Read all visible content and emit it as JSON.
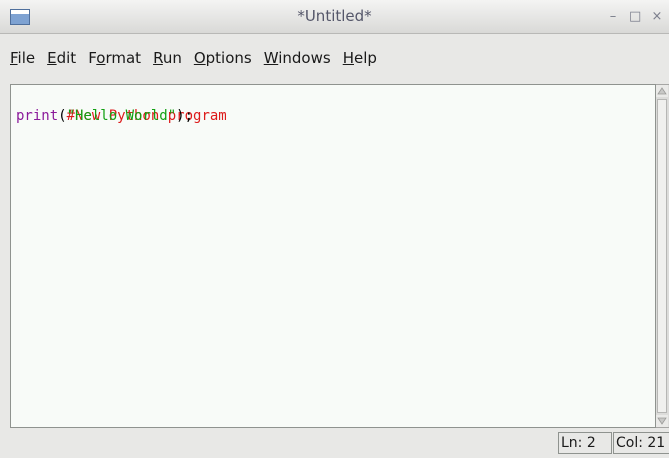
{
  "window": {
    "title": "*Untitled*",
    "controls": {
      "minimize": "–",
      "maximize": "□",
      "close": "×"
    }
  },
  "menu": {
    "items": [
      {
        "mnemonic": "F",
        "rest": "ile"
      },
      {
        "mnemonic": "E",
        "rest": "dit"
      },
      {
        "pre": "F",
        "mnemonic": "o",
        "rest": "rmat"
      },
      {
        "mnemonic": "R",
        "rest": "un"
      },
      {
        "mnemonic": "O",
        "rest": "ptions"
      },
      {
        "mnemonic": "W",
        "rest": "indows"
      },
      {
        "mnemonic": "H",
        "rest": "elp"
      }
    ]
  },
  "editor": {
    "line1": {
      "comment": "#New Python program"
    },
    "line2": {
      "builtin": "print",
      "open": "(",
      "string": "\"Hello World\"",
      "close": ");"
    }
  },
  "status": {
    "line": "Ln: 2",
    "col": "Col: 21"
  },
  "colors": {
    "comment": "#dd1b1b",
    "builtin": "#8b1a9a",
    "string": "#12a012",
    "editor_bg": "#f8fbf8"
  }
}
